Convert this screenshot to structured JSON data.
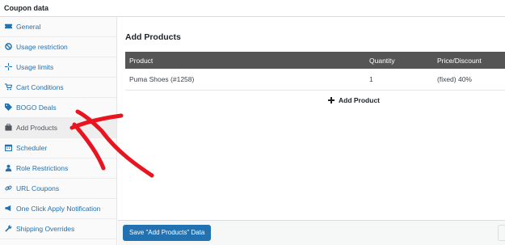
{
  "panel": {
    "title": "Coupon data"
  },
  "sidebar": {
    "items": [
      {
        "label": "General",
        "icon": "ticket-icon"
      },
      {
        "label": "Usage restriction",
        "icon": "block-icon"
      },
      {
        "label": "Usage limits",
        "icon": "crosshair-icon"
      },
      {
        "label": "Cart Conditions",
        "icon": "cart-icon"
      },
      {
        "label": "BOGO Deals",
        "icon": "tag-icon"
      },
      {
        "label": "Add Products",
        "icon": "briefcase-icon",
        "active": true
      },
      {
        "label": "Scheduler",
        "icon": "calendar-icon"
      },
      {
        "label": "Role Restrictions",
        "icon": "user-icon"
      },
      {
        "label": "URL Coupons",
        "icon": "link-icon"
      },
      {
        "label": "One Click Apply Notification",
        "icon": "megaphone-icon"
      },
      {
        "label": "Shipping Overrides",
        "icon": "wrench-icon"
      }
    ]
  },
  "main": {
    "title": "Add Products",
    "table": {
      "headers": {
        "product": "Product",
        "quantity": "Quantity",
        "price": "Price/Discount"
      },
      "rows": [
        {
          "product": "Puma Shoes (#1258)",
          "quantity": "1",
          "price": "(fixed) 40%"
        }
      ]
    },
    "add_product_label": "Add Product"
  },
  "footer": {
    "save_label": "Save \"Add Products\" Data"
  },
  "colors": {
    "link": "#2271b1",
    "table_header": "#555555",
    "button": "#2271b1",
    "annotation_arrow": "#e8141f"
  }
}
